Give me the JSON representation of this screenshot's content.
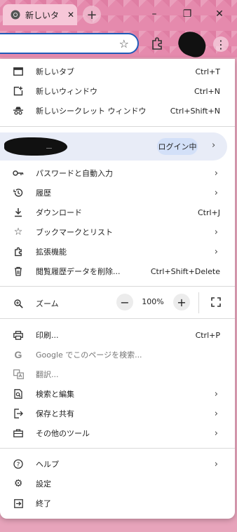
{
  "browser": {
    "tab_title": "新しいタ",
    "tab_close": "✕",
    "new_tab": "+",
    "window_minimize": "–",
    "window_restore": "❐",
    "window_close": "✕"
  },
  "menu": {
    "section1": [
      {
        "icon": "new-tab-icon",
        "label": "新しいタブ",
        "shortcut": "Ctrl+T"
      },
      {
        "icon": "new-window-icon",
        "label": "新しいウィンドウ",
        "shortcut": "Ctrl+N"
      },
      {
        "icon": "incognito-icon",
        "label": "新しいシークレット ウィンドウ",
        "shortcut": "Ctrl+Shift+N"
      }
    ],
    "profile": {
      "status": "ログイン中",
      "arrow": "›"
    },
    "section2": [
      {
        "icon": "key-icon",
        "label": "パスワードと自動入力",
        "arrow": "›"
      },
      {
        "icon": "history-icon",
        "label": "履歴",
        "arrow": "›"
      },
      {
        "icon": "download-icon",
        "label": "ダウンロード",
        "shortcut": "Ctrl+J"
      },
      {
        "icon": "star-icon",
        "label": "ブックマークとリスト",
        "arrow": "›"
      },
      {
        "icon": "extensions-icon",
        "label": "拡張機能",
        "arrow": "›"
      },
      {
        "icon": "trash-icon",
        "label": "閲覧履歴データを削除...",
        "shortcut": "Ctrl+Shift+Delete"
      }
    ],
    "zoom": {
      "label": "ズーム",
      "minus": "−",
      "value": "100%",
      "plus": "+"
    },
    "section3": [
      {
        "icon": "print-icon",
        "label": "印刷...",
        "shortcut": "Ctrl+P"
      },
      {
        "icon": "google-icon",
        "label": "Google でこのページを検索..."
      },
      {
        "icon": "translate-icon",
        "label": "翻訳..."
      },
      {
        "icon": "find-icon",
        "label": "検索と編集",
        "arrow": "›"
      },
      {
        "icon": "save-share-icon",
        "label": "保存と共有",
        "arrow": "›"
      },
      {
        "icon": "toolbox-icon",
        "label": "その他のツール",
        "arrow": "›"
      }
    ],
    "section4": [
      {
        "icon": "help-icon",
        "label": "ヘルプ",
        "arrow": "›"
      },
      {
        "icon": "settings-icon",
        "label": "設定"
      },
      {
        "icon": "exit-icon",
        "label": "終了"
      }
    ]
  }
}
